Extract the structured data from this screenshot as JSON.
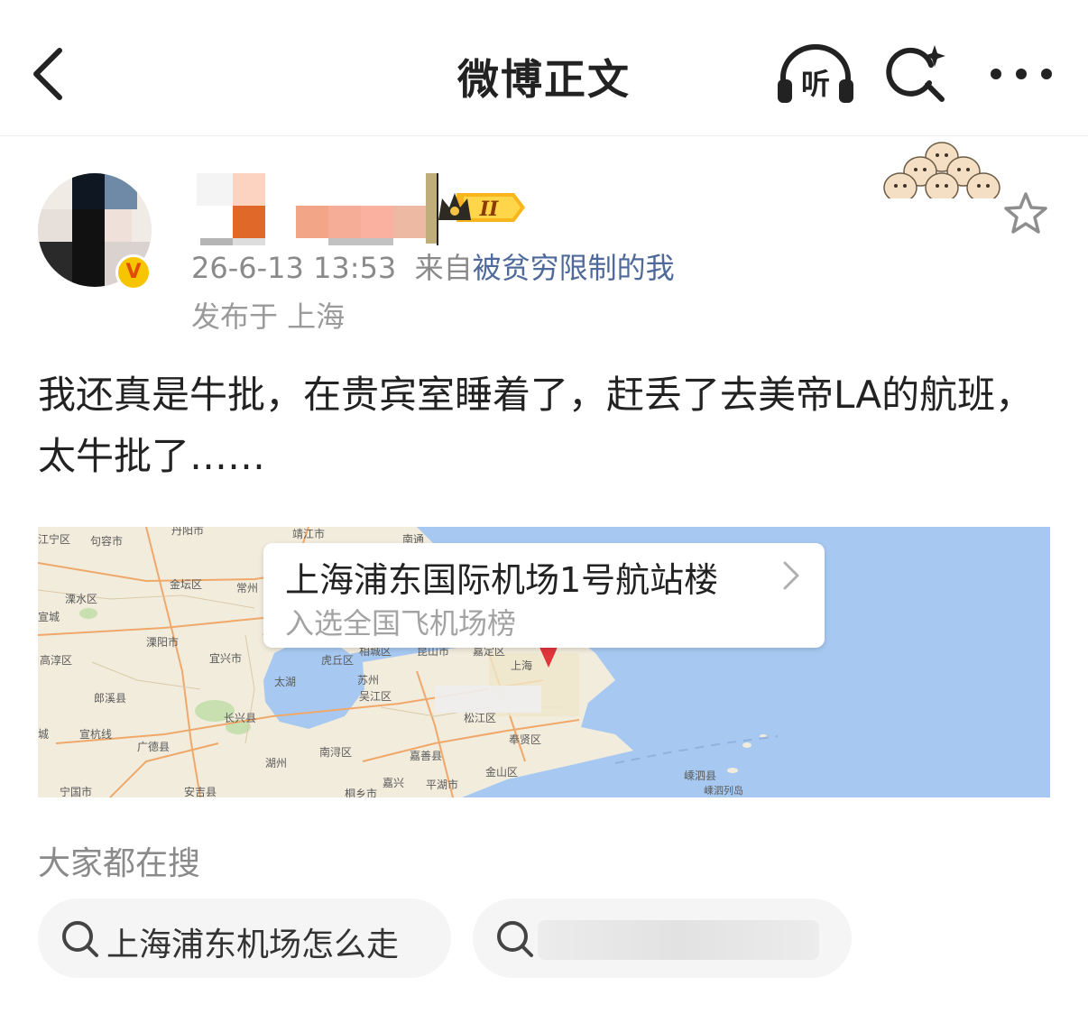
{
  "header": {
    "title": "微博正文",
    "listen_label": "听"
  },
  "post": {
    "verified_badge": "V",
    "rank_badge": "II",
    "meta_time": "26-6-13 13:53",
    "meta_from": "来自",
    "meta_source": "被贫穷限制的我",
    "location": "发布于 上海",
    "content": "我还真是牛批，在贵宾室睡着了，赶丢了去美帝LA的航班，太牛批了……"
  },
  "map": {
    "poi_title": "上海浦东国际机场1号航站楼",
    "poi_subtitle": "入选全国飞机场榜",
    "labels": {
      "l01": "丹阳市",
      "l02": "靖江市",
      "l03": "南通",
      "l04": "江宁区",
      "l05": "句容市",
      "l06": "金坛区",
      "l07": "常州",
      "l08": "溧水区",
      "l09": "高淳区",
      "l10": "溧阳市",
      "l11": "宜兴市",
      "l12": "相城区",
      "l13": "昆山市",
      "l14": "嘉定区",
      "l15": "虎丘区",
      "l16": "苏州",
      "l17": "上海",
      "l18": "太湖",
      "l19": "吴江区",
      "l20": "郎溪县",
      "l21": "宣城",
      "l22": "长兴县",
      "l23": "广德县",
      "l24": "湖州",
      "l25": "南浔区",
      "l26": "嘉善县",
      "l27": "松江区",
      "l28": "奉贤区",
      "l29": "嘉兴",
      "l30": "平湖市",
      "l31": "金山区",
      "l32": "嵊泗县",
      "l33": "嵊泗列岛",
      "l34": "宁国市",
      "l35": "安吉县",
      "l36": "桐乡市",
      "l37": "宣杭线",
      "l38": "城"
    }
  },
  "hot_search": {
    "label": "大家都在搜",
    "items": [
      "上海浦东机场怎么走",
      ""
    ]
  },
  "colors": {
    "sea": "#a7c9f1",
    "land": "#f2ecdd",
    "link": "#4f6a9a",
    "badge_gold": "#f7c400",
    "pin": "#e0353b"
  }
}
